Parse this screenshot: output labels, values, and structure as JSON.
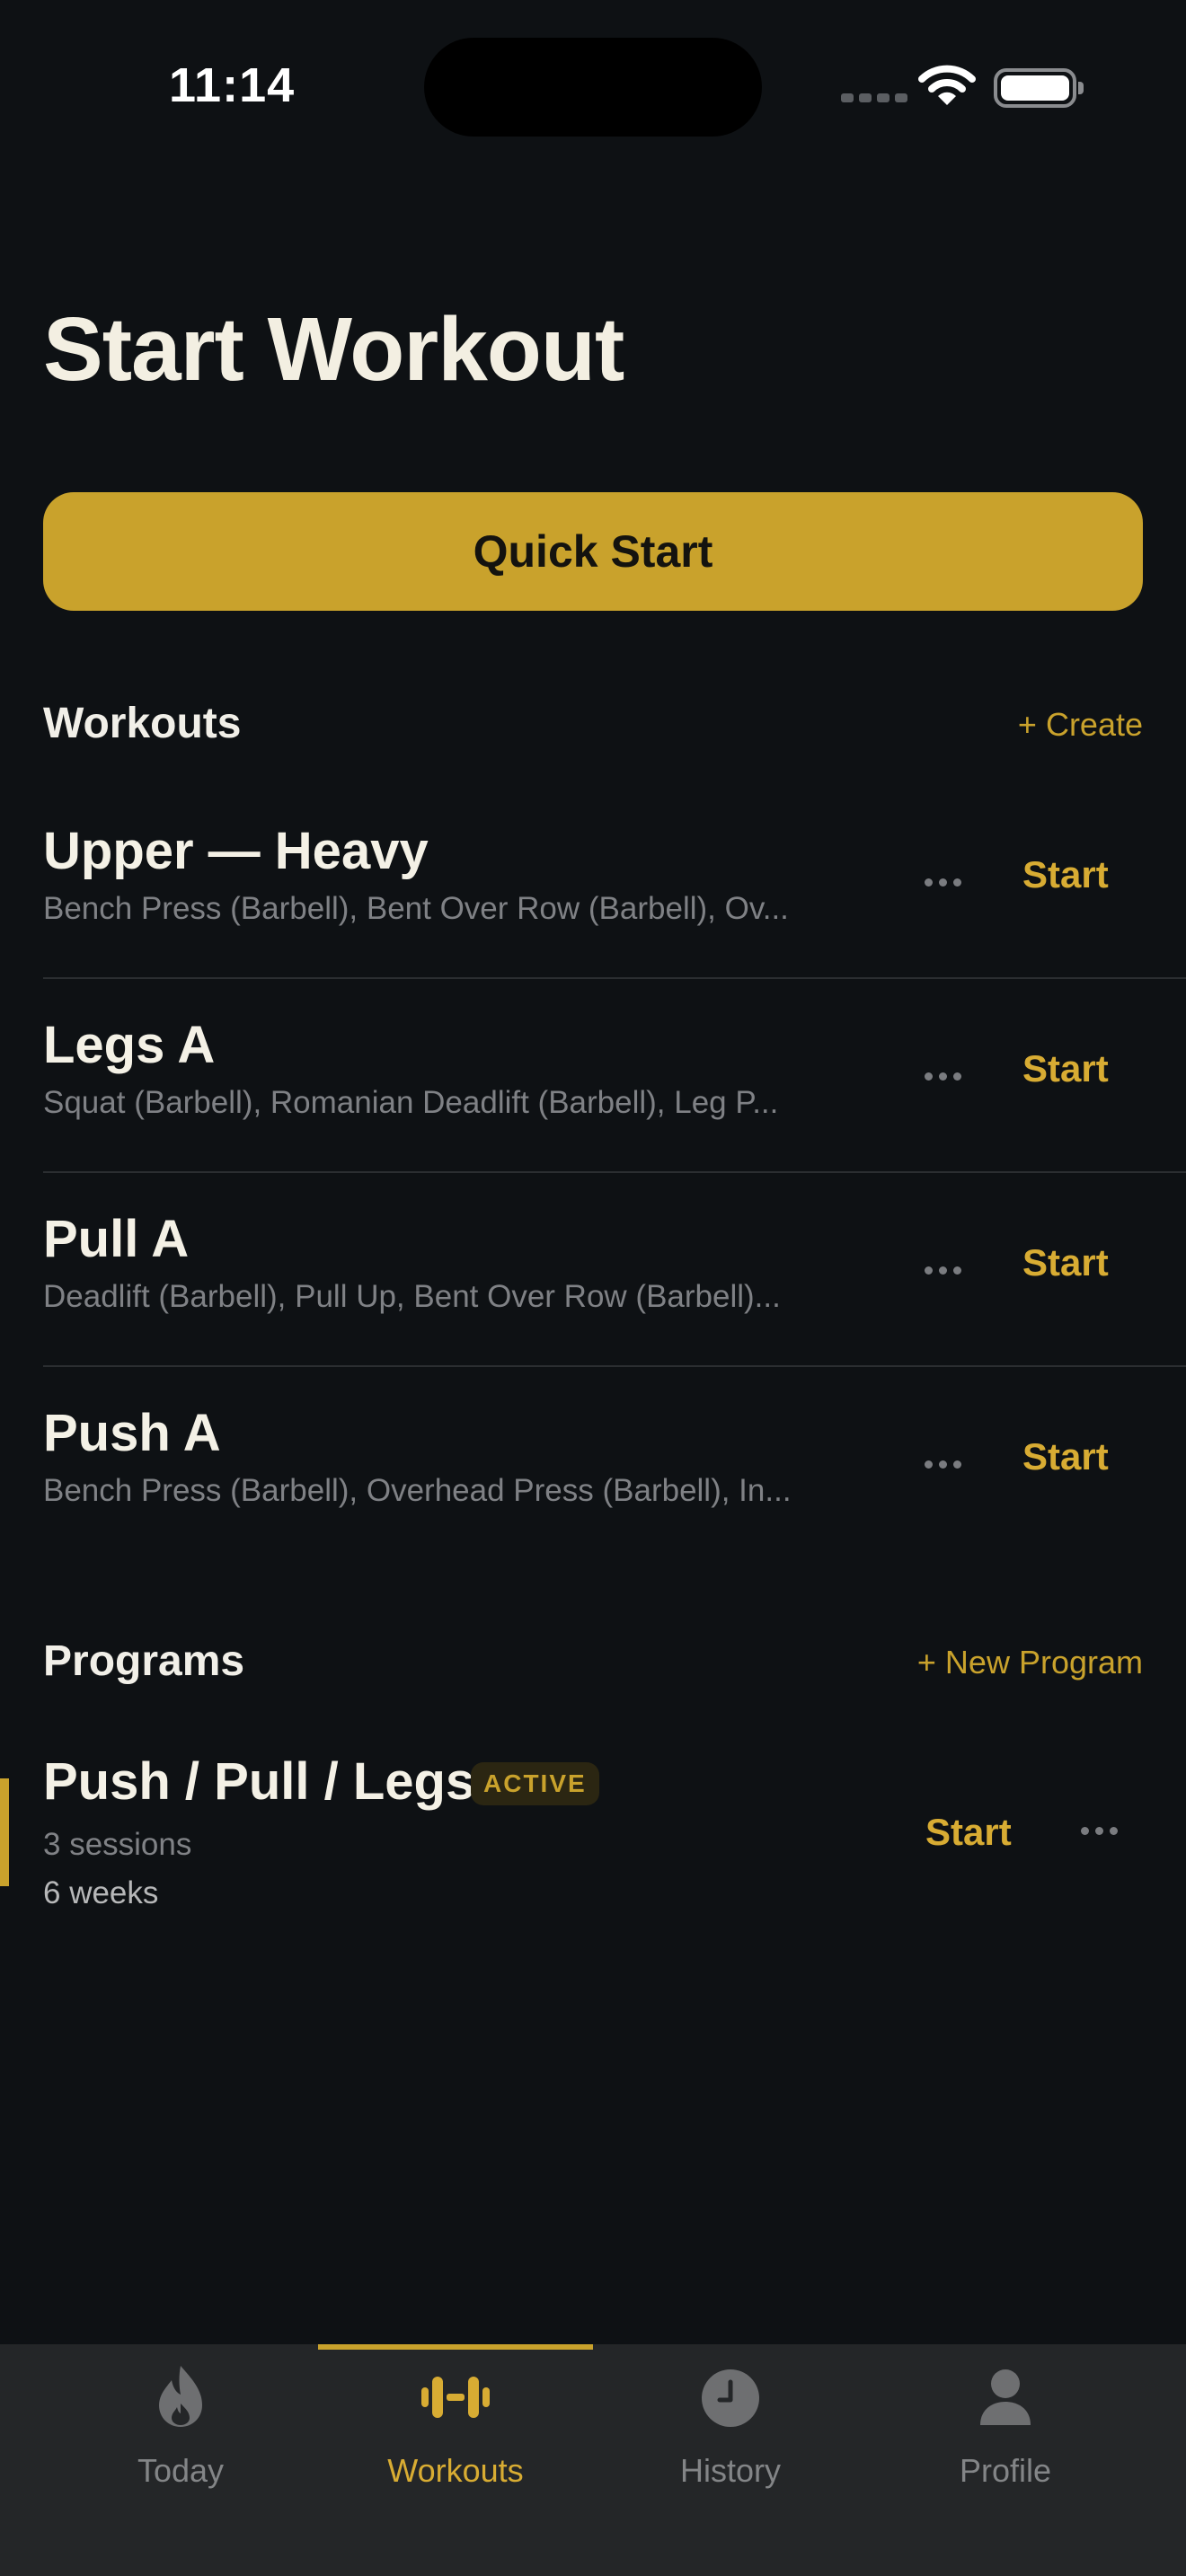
{
  "status_bar": {
    "time": "11:14"
  },
  "page": {
    "title": "Start Workout"
  },
  "quick_start": {
    "label": "Quick Start"
  },
  "workouts_section": {
    "title": "Workouts",
    "action": "+ Create",
    "items": [
      {
        "name": "Upper — Heavy",
        "exercises": "Bench Press (Barbell), Bent Over Row (Barbell), Ov...",
        "start": "Start"
      },
      {
        "name": "Legs A",
        "exercises": "Squat (Barbell), Romanian Deadlift (Barbell), Leg P...",
        "start": "Start"
      },
      {
        "name": "Pull A",
        "exercises": "Deadlift (Barbell), Pull Up, Bent Over Row (Barbell)...",
        "start": "Start"
      },
      {
        "name": "Push A",
        "exercises": "Bench Press (Barbell), Overhead Press (Barbell), In...",
        "start": "Start"
      }
    ]
  },
  "programs_section": {
    "title": "Programs",
    "action": "+ New Program",
    "items": [
      {
        "name": "Push / Pull / Legs",
        "badge": "ACTIVE",
        "sessions": "3 sessions",
        "weeks": "6 weeks",
        "start": "Start"
      }
    ]
  },
  "tab_bar": {
    "tabs": [
      {
        "label": "Today",
        "icon": "flame-icon"
      },
      {
        "label": "Workouts",
        "icon": "dumbbell-icon",
        "active": true
      },
      {
        "label": "History",
        "icon": "clock-icon"
      },
      {
        "label": "Profile",
        "icon": "person-icon"
      }
    ]
  },
  "colors": {
    "accent": "#c9a22c",
    "background": "#0e1114",
    "tab_bar": "#242628"
  }
}
